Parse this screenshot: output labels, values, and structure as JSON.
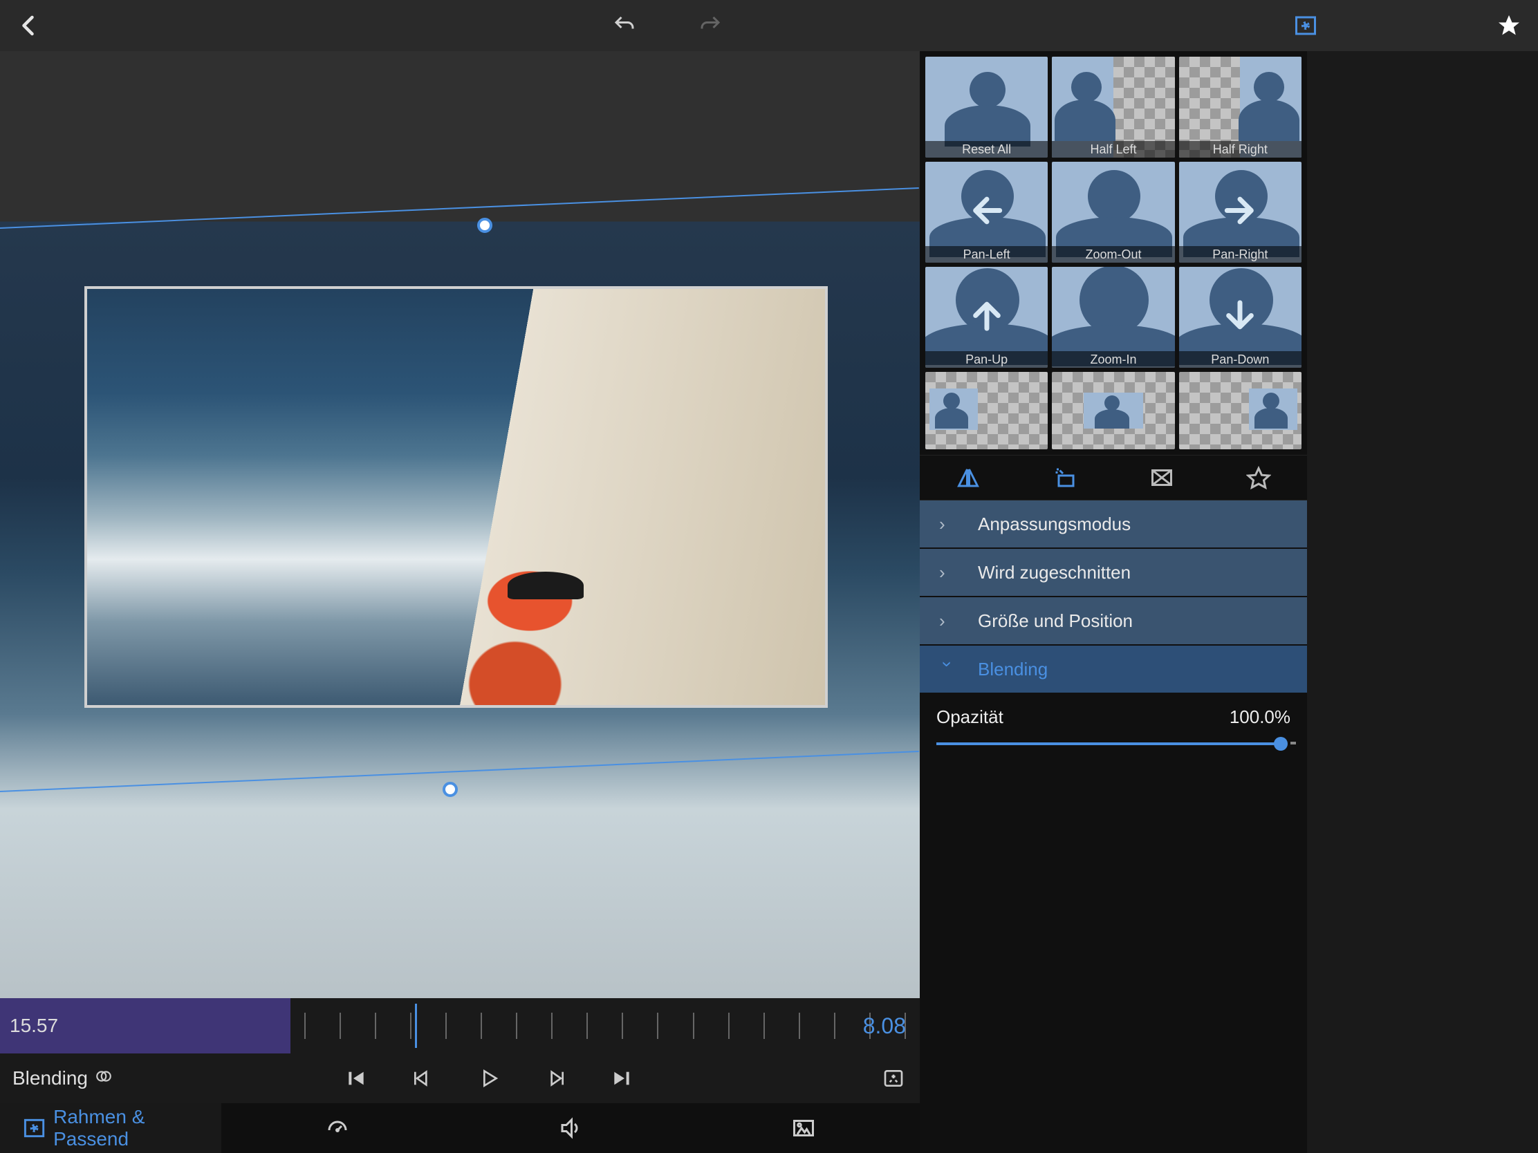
{
  "toolbar": {
    "back": "back",
    "undo": "undo",
    "redo": "redo",
    "frame_fit": "frame-fit",
    "star": "star"
  },
  "timeline": {
    "clip_time": "15.57",
    "remaining": "8.08"
  },
  "playrow": {
    "mode_label": "Blending"
  },
  "bottom_tabs": [
    {
      "id": "frame",
      "label": "Rahmen & Passend",
      "active": true
    },
    {
      "id": "speed",
      "label": ""
    },
    {
      "id": "audio",
      "label": ""
    },
    {
      "id": "fx",
      "label": ""
    }
  ],
  "presets": [
    {
      "label": "Reset All",
      "kind": "full"
    },
    {
      "label": "Half Left",
      "kind": "half-left"
    },
    {
      "label": "Half Right",
      "kind": "half-right"
    },
    {
      "label": "Pan-Left",
      "kind": "arrow-left"
    },
    {
      "label": "Zoom-Out",
      "kind": "zoom-out"
    },
    {
      "label": "Pan-Right",
      "kind": "arrow-right"
    },
    {
      "label": "Pan-Up",
      "kind": "arrow-up"
    },
    {
      "label": "Zoom-In",
      "kind": "zoom-in"
    },
    {
      "label": "Pan-Down",
      "kind": "arrow-down"
    },
    {
      "label": "",
      "kind": "small-left"
    },
    {
      "label": "",
      "kind": "small-center"
    },
    {
      "label": "",
      "kind": "small-right"
    }
  ],
  "accordion": [
    {
      "label": "Anpassungsmodus",
      "active": false
    },
    {
      "label": "Wird zugeschnitten",
      "active": false
    },
    {
      "label": "Größe und Position",
      "active": false
    },
    {
      "label": "Blending",
      "active": true
    }
  ],
  "opacity": {
    "label": "Opazität",
    "value": "100.0%"
  }
}
